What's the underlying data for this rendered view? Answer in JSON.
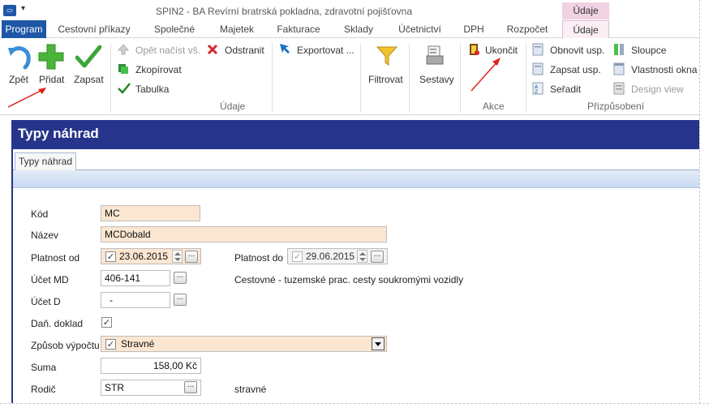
{
  "window": {
    "title": "SPIN2 - BA Revírní bratrská pokladna, zdravotní pojišťovna",
    "context_tab_header": "Údaje",
    "qat_arrow": "▾",
    "app_icon_text": "▭"
  },
  "tabs": [
    {
      "label": "Program",
      "active": false
    },
    {
      "label": "Cestovní příkazy"
    },
    {
      "label": "Společné"
    },
    {
      "label": "Majetek"
    },
    {
      "label": "Fakturace"
    },
    {
      "label": "Sklady"
    },
    {
      "label": "Účetnictví"
    },
    {
      "label": "DPH"
    },
    {
      "label": "Rozpočet"
    },
    {
      "label": "Údaje",
      "active": true
    }
  ],
  "ribbon": {
    "udaje_group": {
      "label": "Údaje",
      "back": "Zpět",
      "add": "Přidat",
      "save": "Zapsat",
      "reload_all": "Opět načíst vš.",
      "copy": "Zkopírovat",
      "table": "Tabulka",
      "delete": "Odstranit",
      "export": "Exportovat ...",
      "filter": "Filtrovat",
      "reports": "Sestavy"
    },
    "akce_group": {
      "label": "Akce",
      "exit": "Ukončit"
    },
    "customize_group": {
      "label": "Přizpůsobení",
      "refresh_layout": "Obnovit usp.",
      "save_layout": "Zapsat usp.",
      "sort": "Seřadit",
      "columns": "Sloupce",
      "window_props": "Vlastnosti okna",
      "design_view": "Design view"
    }
  },
  "form": {
    "title": "Typy náhrad",
    "tab_label": "Typy náhrad",
    "fields": {
      "kod": {
        "label": "Kód",
        "value": "MC"
      },
      "nazev": {
        "label": "Název",
        "value": "MCDobald"
      },
      "platnost_od": {
        "label": "Platnost od",
        "value": "23.06.2015",
        "checked": "✓"
      },
      "platnost_do": {
        "label": "Platnost do",
        "value": "29.06.2015",
        "checked": "✓"
      },
      "ucet_md": {
        "label": "Účet MD",
        "value": "406-141",
        "description": "Cestovné - tuzemské prac. cesty soukromými vozidly"
      },
      "ucet_d": {
        "label": "Účet D",
        "value": "-"
      },
      "dan_doklad": {
        "label": "Daň. doklad",
        "checked": "✓"
      },
      "zpusob_vypoctu": {
        "label": "Způsob výpočtu",
        "value": "Stravné",
        "checked": "✓"
      },
      "suma": {
        "label": "Suma",
        "value": "158,00 Kč"
      },
      "rodic": {
        "label": "Rodič",
        "value": "STR",
        "description": "stravné"
      }
    },
    "dots_button": "..."
  },
  "colors": {
    "accent_blue": "#1f57a7",
    "form_header": "#26348c",
    "field_bg": "#fbe6d2",
    "context_tab": "#f1d2e3",
    "annotation_arrow": "#e0201a"
  }
}
